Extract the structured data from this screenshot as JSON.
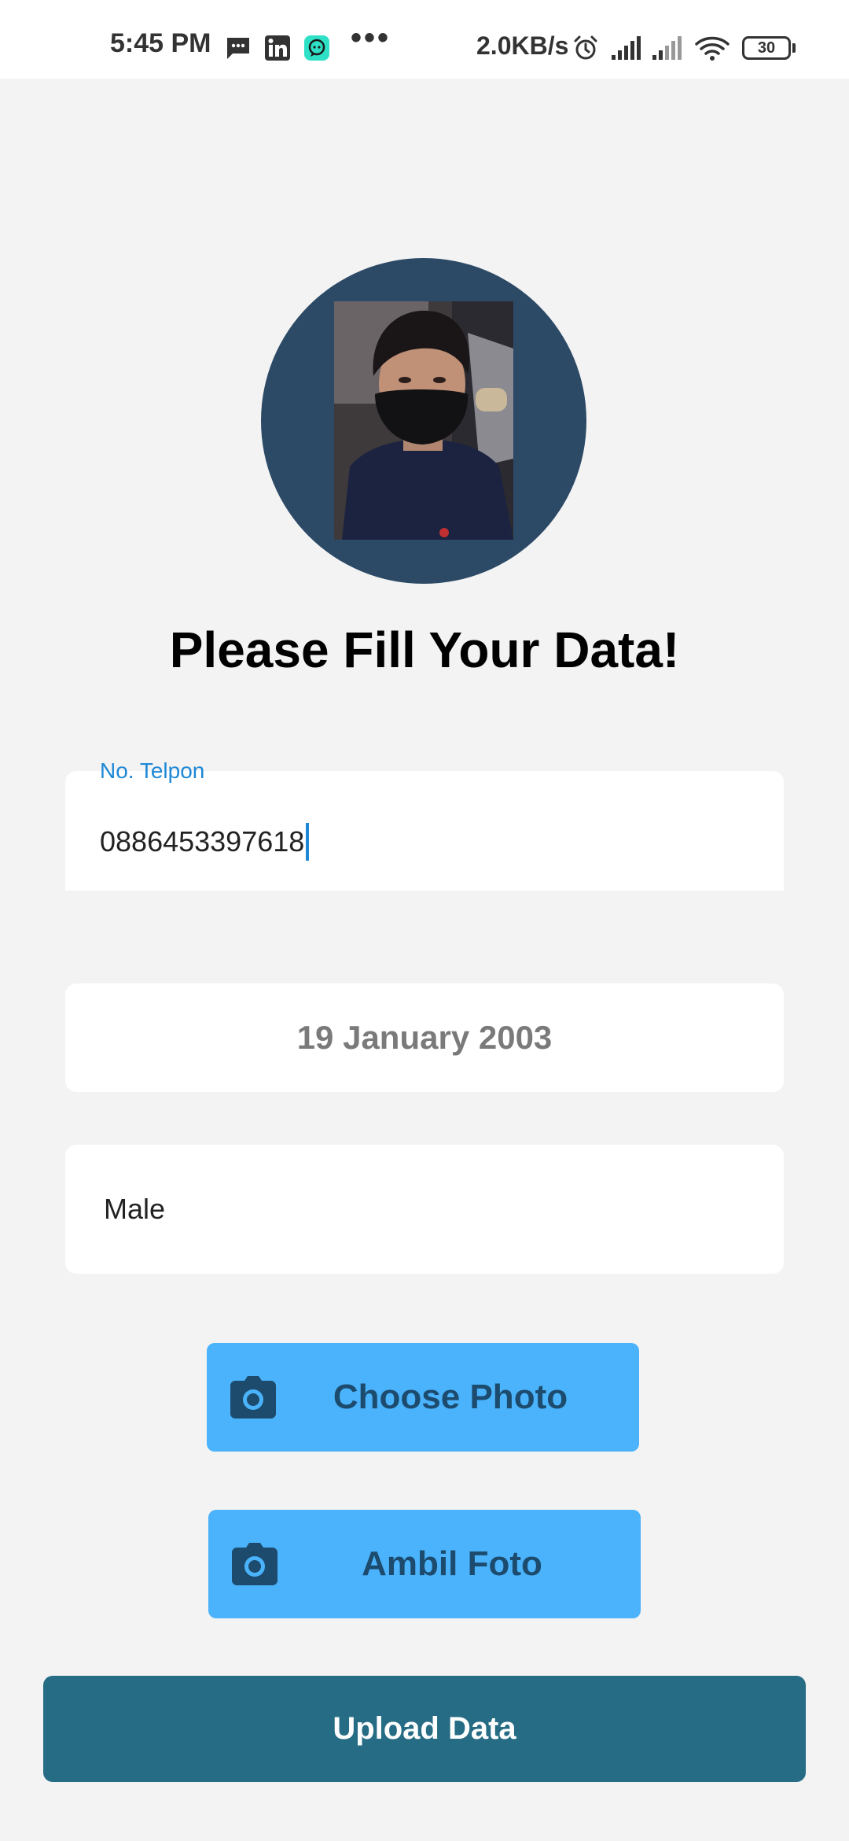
{
  "status_bar": {
    "time": "5:45 PM",
    "net_speed": "2.0KB/s",
    "battery": "30",
    "overflow": "•••"
  },
  "page": {
    "title": "Please Fill Your Data!"
  },
  "form": {
    "phone": {
      "label": "No. Telpon",
      "value": "0886453397618"
    },
    "birth_date": "19 January 2003",
    "gender": "Male"
  },
  "buttons": {
    "choose_photo": "Choose Photo",
    "take_photo": "Ambil Foto",
    "upload": "Upload Data"
  },
  "colors": {
    "background": "#f3f3f3",
    "avatar_bg": "#2c4a66",
    "accent": "#1e88d6",
    "photo_button": "#4ab3fb",
    "photo_button_text": "#1d4b6e",
    "upload_button": "#256c84"
  },
  "icons": {
    "photo_button_icon": "camera-icon"
  }
}
